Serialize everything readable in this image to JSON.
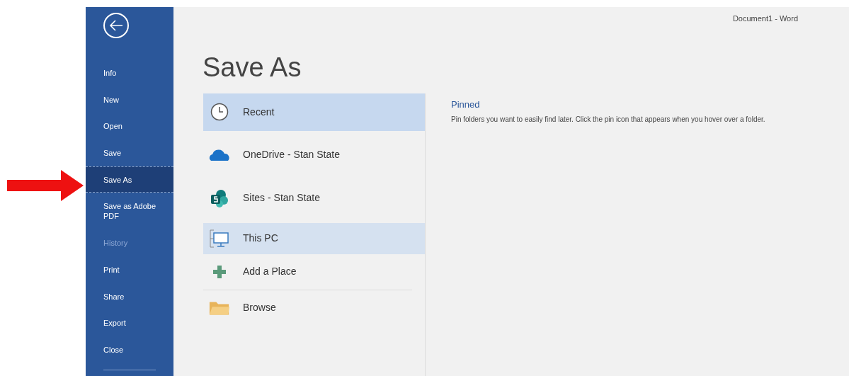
{
  "window": {
    "title": "Document1  -  Word"
  },
  "sidebar": {
    "items": [
      {
        "label": "Info",
        "selected": false,
        "disabled": false
      },
      {
        "label": "New",
        "selected": false,
        "disabled": false
      },
      {
        "label": "Open",
        "selected": false,
        "disabled": false
      },
      {
        "label": "Save",
        "selected": false,
        "disabled": false
      },
      {
        "label": "Save As",
        "selected": true,
        "disabled": false
      },
      {
        "label": "Save as Adobe PDF",
        "selected": false,
        "disabled": false
      },
      {
        "label": "History",
        "selected": false,
        "disabled": true
      },
      {
        "label": "Print",
        "selected": false,
        "disabled": false
      },
      {
        "label": "Share",
        "selected": false,
        "disabled": false
      },
      {
        "label": "Export",
        "selected": false,
        "disabled": false
      },
      {
        "label": "Close",
        "selected": false,
        "disabled": false
      }
    ]
  },
  "page_title": "Save As",
  "places": [
    {
      "kind": "clock",
      "label": "Recent",
      "selected": true,
      "hovered": false
    },
    {
      "kind": "cloud",
      "label": "OneDrive - Stan State",
      "selected": false,
      "hovered": false
    },
    {
      "kind": "sites",
      "label": "Sites - Stan State",
      "selected": false,
      "hovered": false
    },
    {
      "kind": "pc",
      "label": "This PC",
      "selected": false,
      "hovered": true
    },
    {
      "kind": "plus",
      "label": "Add a Place",
      "selected": false,
      "hovered": false
    },
    {
      "kind": "folder",
      "label": "Browse",
      "selected": false,
      "hovered": false
    }
  ],
  "pinned": {
    "heading": "Pinned",
    "text": "Pin folders you want to easily find later. Click the pin icon that appears when you hover over a folder."
  }
}
